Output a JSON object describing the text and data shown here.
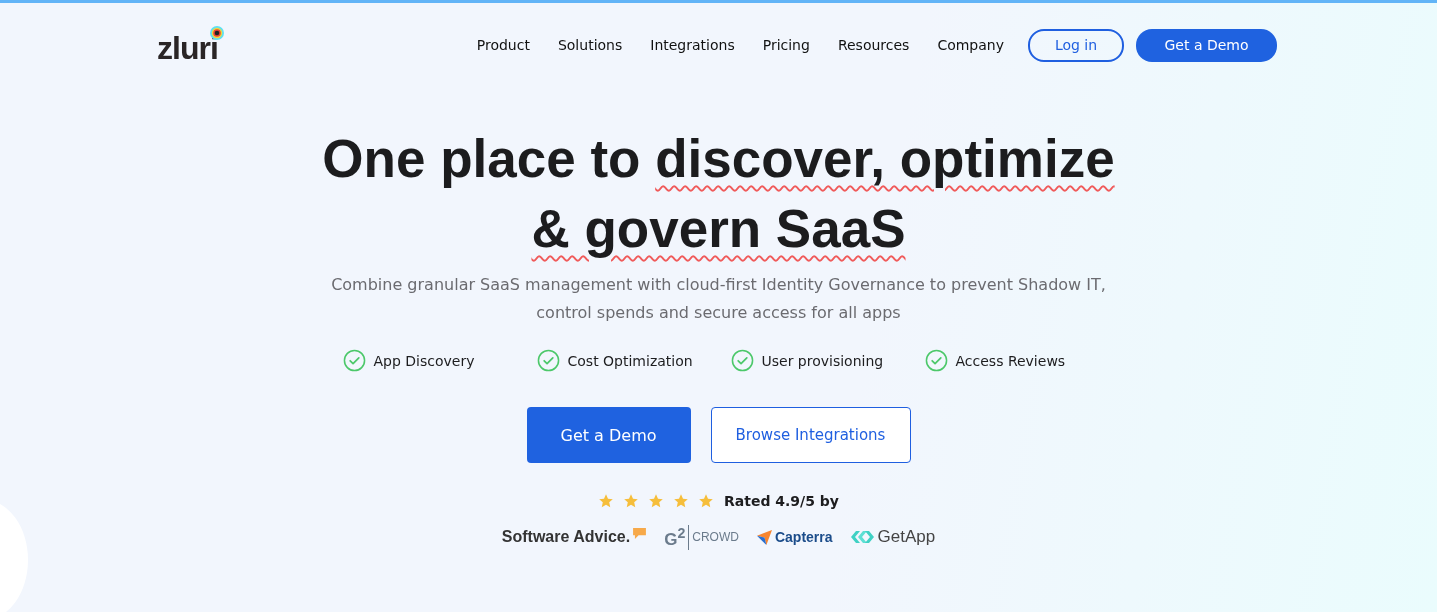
{
  "header": {
    "logo": "zluri",
    "nav": [
      "Product",
      "Solutions",
      "Integrations",
      "Pricing",
      "Resources",
      "Company"
    ],
    "login": "Log in",
    "demo": "Get a Demo"
  },
  "hero": {
    "headline_lines": [
      [
        {
          "text": "One place to ",
          "underlined": false
        },
        {
          "text": "discover, optimize",
          "underlined": true
        }
      ],
      [
        {
          "text": "& govern SaaS",
          "underlined": true
        }
      ]
    ],
    "subtitle": "Combine granular SaaS management with cloud-first Identity Governance to prevent Shadow IT, control spends and secure access for all apps",
    "features": [
      "App Discovery",
      "Cost Optimization",
      "User provisioning",
      "Access Reviews"
    ],
    "primary_button": "Get a Demo",
    "secondary_button": "Browse Integrations",
    "rating": {
      "stars": 5,
      "text": "Rated 4.9/5 by"
    },
    "reviewers": [
      {
        "kind": "softwareadvice",
        "name": "Software Advice."
      },
      {
        "kind": "g2",
        "mark": "G$^{2}$",
        "name": "CROWD"
      },
      {
        "kind": "capterra",
        "name": "Capterra"
      },
      {
        "kind": "getapp",
        "name": "GetApp"
      }
    ]
  }
}
